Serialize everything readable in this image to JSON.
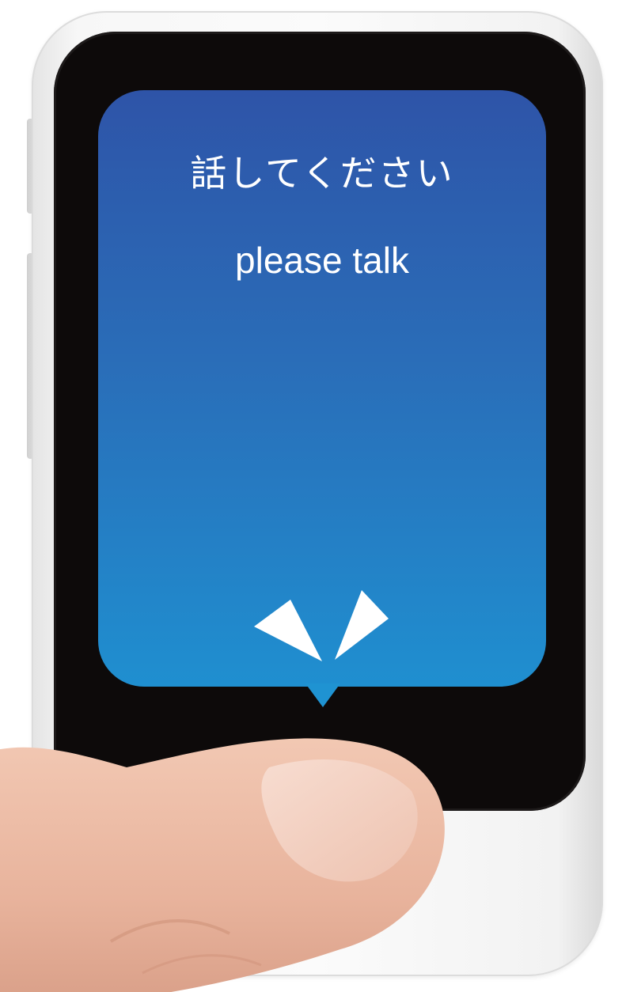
{
  "screen": {
    "prompt_japanese": "話してください",
    "prompt_english": "please talk"
  },
  "icons": {
    "listening_indicator": "sound-wave-indicator-icon"
  },
  "colors": {
    "display_top": "#2e54a8",
    "display_bottom": "#1f8fd0",
    "bezel": "#0d0a0a",
    "device_body": "#f7f7f7",
    "text": "#ffffff"
  }
}
